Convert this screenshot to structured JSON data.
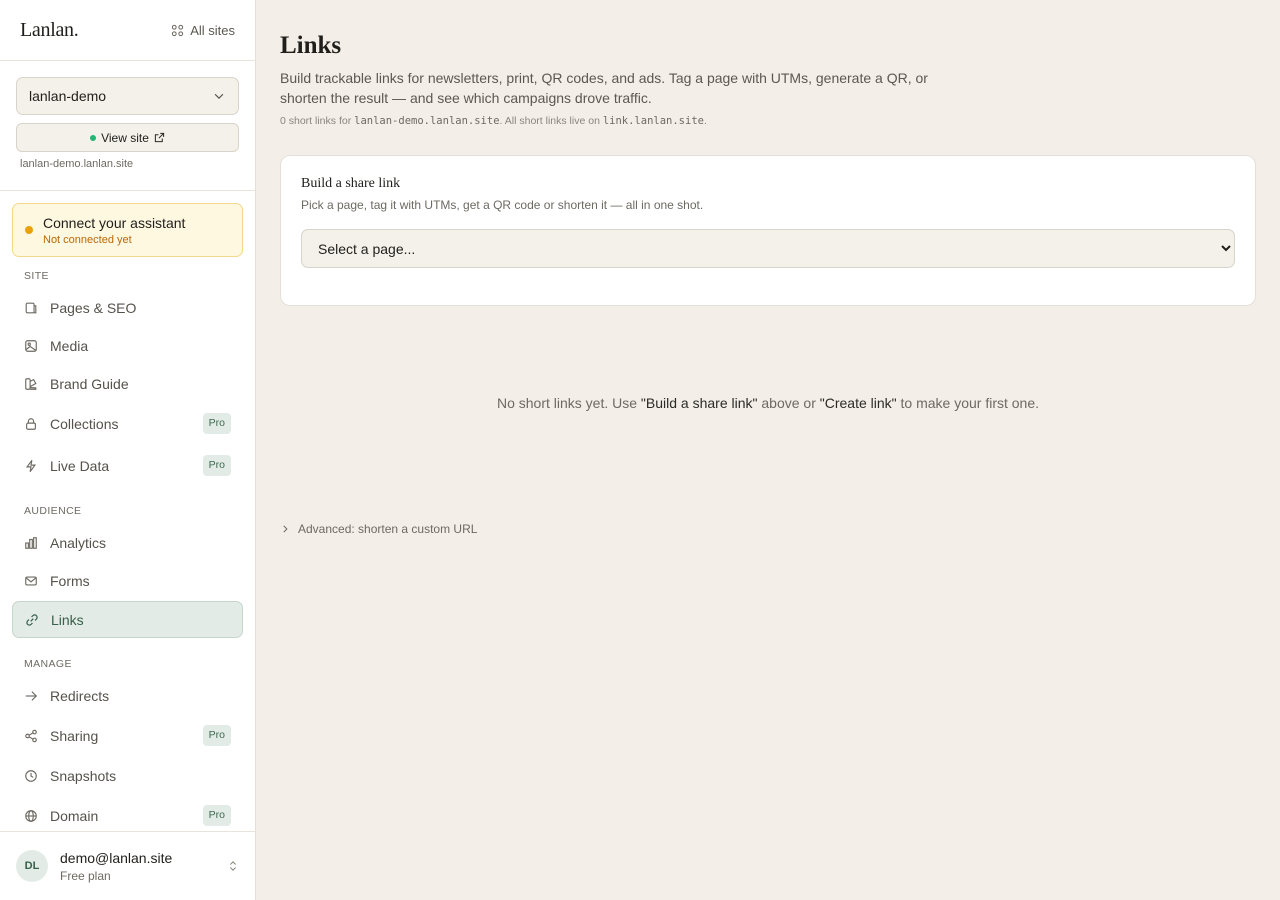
{
  "sidebar": {
    "logo": "Lanlan.",
    "all_sites": "All sites",
    "site_select": "lanlan-demo",
    "view_site": "View site",
    "site_domain": "lanlan-demo.lanlan.site",
    "assistant": {
      "title": "Connect your assistant",
      "status": "Not connected yet"
    },
    "sections": {
      "site": "SITE",
      "audience": "AUDIENCE",
      "manage": "MANAGE"
    },
    "items": {
      "pages": {
        "label": "Pages & SEO",
        "icon": "file-icon"
      },
      "media": {
        "label": "Media",
        "icon": "image-icon"
      },
      "brand": {
        "label": "Brand Guide",
        "icon": "palette-icon"
      },
      "collections": {
        "label": "Collections",
        "icon": "lock-icon",
        "badge": "Pro"
      },
      "live_data": {
        "label": "Live Data",
        "icon": "lightning-icon",
        "badge": "Pro"
      },
      "analytics": {
        "label": "Analytics",
        "icon": "bar-chart-icon"
      },
      "forms": {
        "label": "Forms",
        "icon": "mail-icon"
      },
      "links": {
        "label": "Links",
        "icon": "link-icon",
        "active": true
      },
      "redirects": {
        "label": "Redirects",
        "icon": "arrow-right-icon"
      },
      "sharing": {
        "label": "Sharing",
        "icon": "share-icon",
        "badge": "Pro"
      },
      "snapshots": {
        "label": "Snapshots",
        "icon": "clock-icon"
      },
      "domain": {
        "label": "Domain",
        "icon": "globe-icon",
        "badge": "Pro"
      }
    },
    "user": {
      "initials": "DL",
      "email": "demo@lanlan.site",
      "plan": "Free plan"
    }
  },
  "main": {
    "title": "Links",
    "description": "Build trackable links for newsletters, print, QR codes, and ads. Tag a page with UTMs, generate a QR, or shorten the result — and see which campaigns drove traffic.",
    "meta": {
      "count_prefix": "0 short links for ",
      "site_host": "lanlan-demo.lanlan.site",
      "middle": ". All short links live on ",
      "link_host": "link.lanlan.site",
      "suffix": "."
    },
    "card": {
      "title": "Build a share link",
      "subtitle": "Pick a page, tag it with UTMs, get a QR code or shorten it — all in one shot.",
      "select_placeholder": "Select a page..."
    },
    "empty": {
      "prefix": "No short links yet. Use ",
      "cta1": "\"Build a share link\"",
      "middle": " above or ",
      "cta2": "\"Create link\"",
      "suffix": " to make your first one."
    },
    "advanced": "Advanced: shorten a custom URL"
  },
  "colors": {
    "accent": "#35604a",
    "accent_bg": "#e3ebe6",
    "warning": "#e9a20c",
    "online": "#22b573"
  }
}
